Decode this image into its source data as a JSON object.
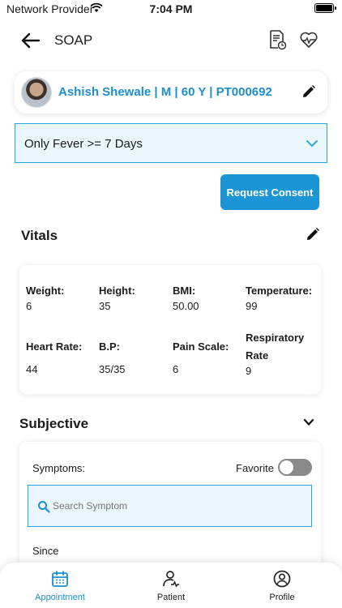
{
  "status_bar": {
    "carrier": "Network Provider",
    "time": "7:04 PM"
  },
  "header": {
    "title": "SOAP"
  },
  "patient": {
    "label": "Ashish Shewale | M | 60 Y | PT000692"
  },
  "complaint": {
    "selected": "Only Fever >= 7 Days"
  },
  "consent_button": "Request Consent",
  "vitals": {
    "title": "Vitals",
    "items": [
      {
        "label": "Weight:",
        "value": "6"
      },
      {
        "label": "Height:",
        "value": "35"
      },
      {
        "label": "BMI:",
        "value": "50.00"
      },
      {
        "label": "Temperature:",
        "value": "99"
      },
      {
        "label": "Heart Rate:",
        "value": "44"
      },
      {
        "label": "B.P:",
        "value": "35/35"
      },
      {
        "label": "Pain Scale:",
        "value": "6"
      },
      {
        "label": "Respiratory Rate",
        "value": "9"
      }
    ]
  },
  "subjective": {
    "title": "Subjective",
    "symptoms_label": "Symptoms:",
    "favorite_label": "Favorite",
    "favorite_on": false,
    "search_placeholder": "Search Symptom",
    "since_label": "Since"
  },
  "bottom_nav": {
    "items": [
      {
        "label": "Appointment",
        "icon": "calendar-icon",
        "active": true
      },
      {
        "label": "Patient",
        "icon": "patient-icon",
        "active": false
      },
      {
        "label": "Profile",
        "icon": "profile-icon",
        "active": false
      }
    ]
  },
  "colors": {
    "accent": "#1b95d6",
    "accent_light": "#eaf6fb",
    "active_nav": "#1b8fcf"
  }
}
